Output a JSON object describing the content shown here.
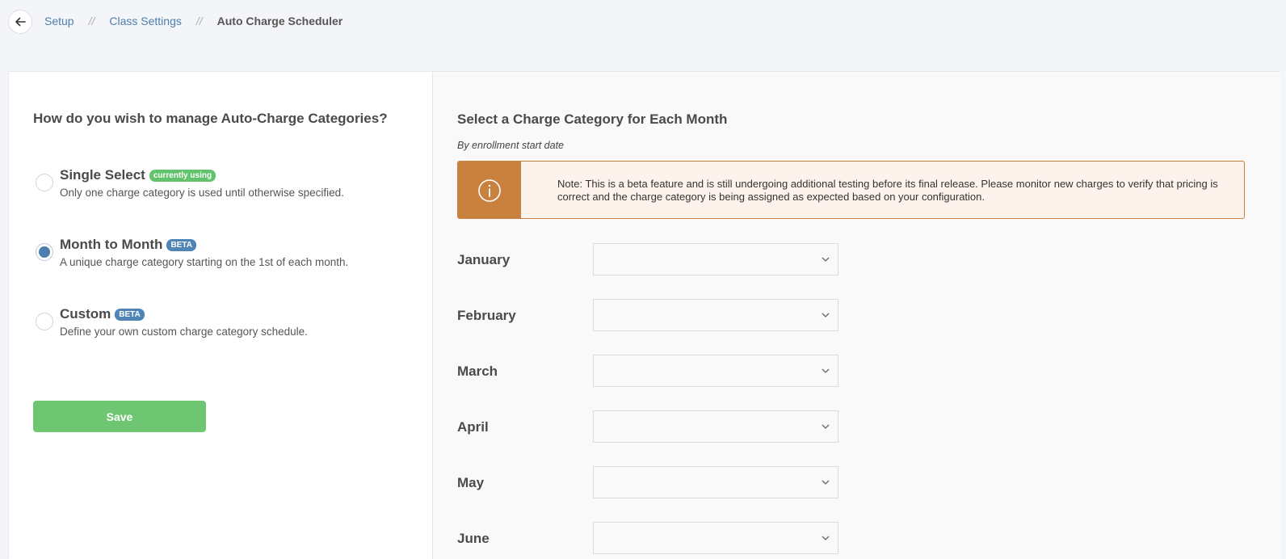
{
  "breadcrumb": {
    "items": [
      "Setup",
      "Class Settings"
    ],
    "separator": "//",
    "current": "Auto Charge Scheduler"
  },
  "left": {
    "title": "How do you wish to manage Auto-Charge Categories?",
    "options": [
      {
        "title": "Single Select",
        "badge": "currently using",
        "badge_color": "#61c46c",
        "desc": "Only one charge category is used until otherwise specified.",
        "selected": false
      },
      {
        "title": "Month to Month",
        "badge": "BETA",
        "badge_color": "#4e85b6",
        "desc": "A unique charge category starting on the 1st of each month.",
        "selected": true
      },
      {
        "title": "Custom",
        "badge": "BETA",
        "badge_color": "#4e85b6",
        "desc": "Define your own custom charge category schedule.",
        "selected": false
      }
    ],
    "save_label": "Save"
  },
  "right": {
    "title": "Select a Charge Category for Each Month",
    "subtitle": "By enrollment start date",
    "alert": {
      "icon": "info-icon",
      "text": "Note: This is a beta feature and is still undergoing additional testing before its final release. Please monitor new charges to verify that pricing is correct and the charge category is being assigned as expected based on your configuration."
    },
    "months": [
      {
        "label": "January",
        "value": ""
      },
      {
        "label": "February",
        "value": ""
      },
      {
        "label": "March",
        "value": ""
      },
      {
        "label": "April",
        "value": ""
      },
      {
        "label": "May",
        "value": ""
      },
      {
        "label": "June",
        "value": ""
      }
    ]
  },
  "colors": {
    "accent_blue": "#4d7cb0",
    "save_green": "#6ec672",
    "warning_orange": "#c8813f"
  }
}
